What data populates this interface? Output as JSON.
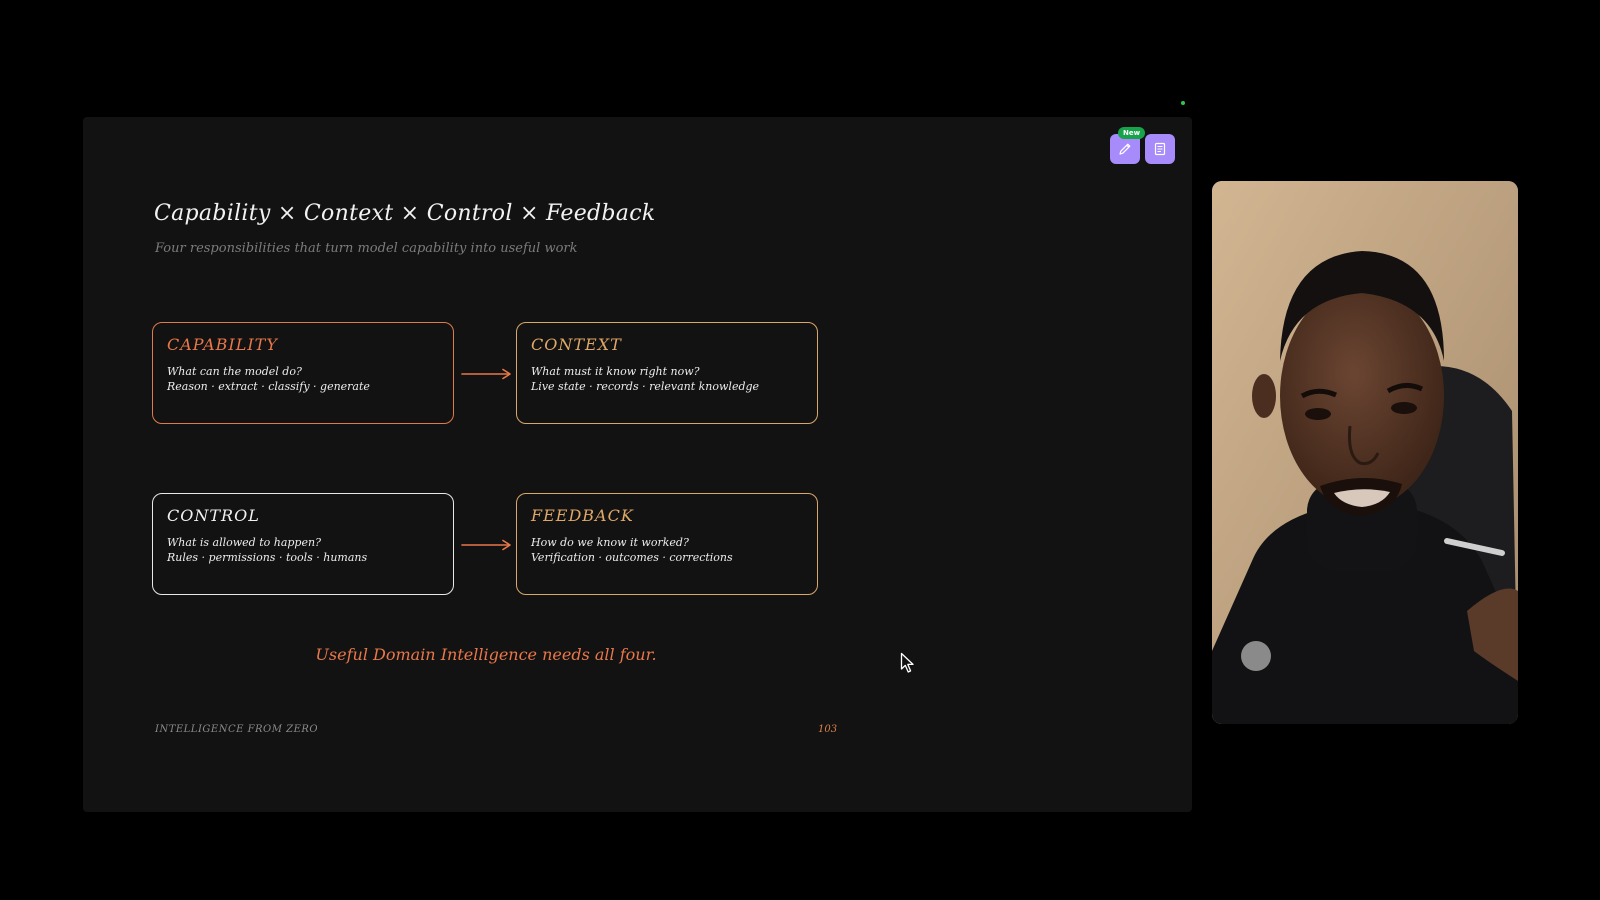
{
  "toolbar": {
    "new_badge": "New",
    "pen_icon": "pen-icon",
    "notes_icon": "notes-icon"
  },
  "slide": {
    "title": "Capability × Context × Control × Feedback",
    "subtitle": "Four responsibilities that turn model capability into useful work",
    "cards": {
      "capability": {
        "title": "CAPABILITY",
        "question": "What can the model do?",
        "details": "Reason · extract · classify · generate"
      },
      "context": {
        "title": "CONTEXT",
        "question": "What must it know right now?",
        "details": "Live state · records · relevant knowledge"
      },
      "control": {
        "title": "CONTROL",
        "question": "What is allowed to happen?",
        "details": "Rules · permissions · tools · humans"
      },
      "feedback": {
        "title": "FEEDBACK",
        "question": "How do we know it worked?",
        "details": "Verification · outcomes · corrections"
      }
    },
    "tagline": "Useful Domain Intelligence needs all four.",
    "footer_left": "INTELLIGENCE FROM ZERO",
    "page_number": "103"
  },
  "colors": {
    "accent_orange": "#e8784a",
    "accent_gold": "#e0a868",
    "toolbar_purple": "#a78bfa",
    "badge_green": "#16a34a",
    "slide_background": "#121212"
  }
}
